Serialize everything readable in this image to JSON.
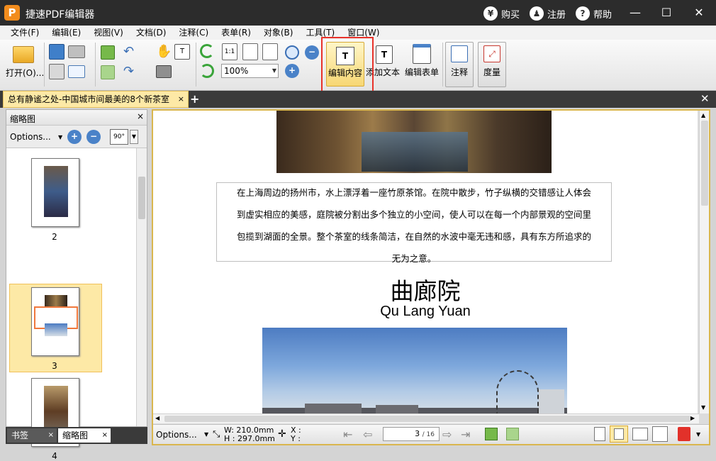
{
  "app": {
    "logo": "P",
    "title": "捷速PDF编辑器"
  },
  "title_actions": [
    {
      "icon": "¥",
      "label": "购买"
    },
    {
      "icon": "♟",
      "label": "注册"
    },
    {
      "icon": "?",
      "label": "帮助"
    }
  ],
  "window_controls": {
    "minimize": "—",
    "maximize": "☐",
    "close": "✕"
  },
  "menu": [
    "文件(F)",
    "编辑(E)",
    "视图(V)",
    "文档(D)",
    "注释(C)",
    "表单(R)",
    "对象(B)",
    "工具(T)",
    "窗口(W)"
  ],
  "toolbar": {
    "open_label": "打开(O)...",
    "zoom_value": "100%",
    "fit_actual": "1:1",
    "edit_content": "编辑内容",
    "add_text": "添加文本",
    "edit_form": "编辑表单",
    "annotate": "注释",
    "measure": "度量"
  },
  "tabs": {
    "document": "总有静谧之处-中国城市间最美的8个新茶室",
    "close": "×",
    "add": "+",
    "close_all": "✕"
  },
  "left_panel": {
    "title": "缩略图",
    "close": "×",
    "options": "Options...",
    "rotate_label": "90°",
    "thumbnails": [
      {
        "page": "2"
      },
      {
        "page": "3",
        "selected": true
      },
      {
        "page": "4"
      }
    ],
    "bottom_tabs": [
      "书签",
      "缩略图"
    ]
  },
  "document": {
    "paragraph_lines": [
      "在上海周边的扬州市，水上漂浮着一座竹原茶馆。在院中散步，竹子纵横的交错感让人体会",
      "到虚实相应的美感，庭院被分割出多个独立的小空间，使人可以在每一个内部景观的空间里",
      "包揽到湖面的全景。整个茶室的线条简洁，在自然的水波中毫无违和感，具有东方所追求的",
      "无为之意。"
    ],
    "heading_cn": "曲廊院",
    "heading_en": "Qu Lang Yuan"
  },
  "status": {
    "options": "Options...",
    "width": "W: 210.0mm",
    "height": "H : 297.0mm",
    "x": "X :",
    "y": "Y :",
    "page_current": "3",
    "page_total": "/ 16"
  }
}
